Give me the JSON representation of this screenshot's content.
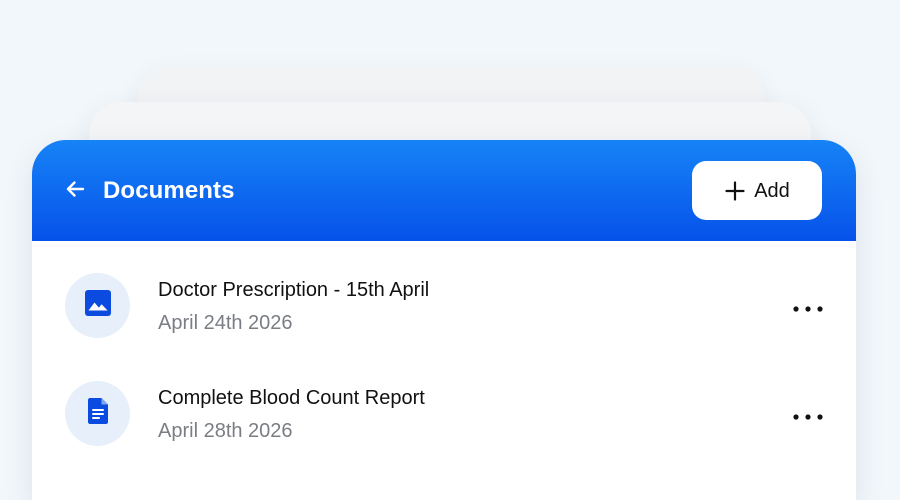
{
  "header": {
    "title": "Documents",
    "add_label": "Add",
    "back_icon": "arrow-left-icon",
    "add_icon": "plus-icon"
  },
  "documents": [
    {
      "title": "Doctor Prescription - 15th April",
      "date": "April 24th 2026",
      "icon": "image-icon"
    },
    {
      "title": "Complete Blood Count Report",
      "date": "April 28th 2026",
      "icon": "document-icon"
    }
  ],
  "more_icon": "more-horizontal-icon",
  "colors": {
    "header_gradient_top": "#1683f6",
    "header_gradient_bottom": "#0752ea",
    "icon_accent": "#0c4be0",
    "icon_bubble": "#e6effa",
    "page_bg": "#f2f7fb"
  }
}
